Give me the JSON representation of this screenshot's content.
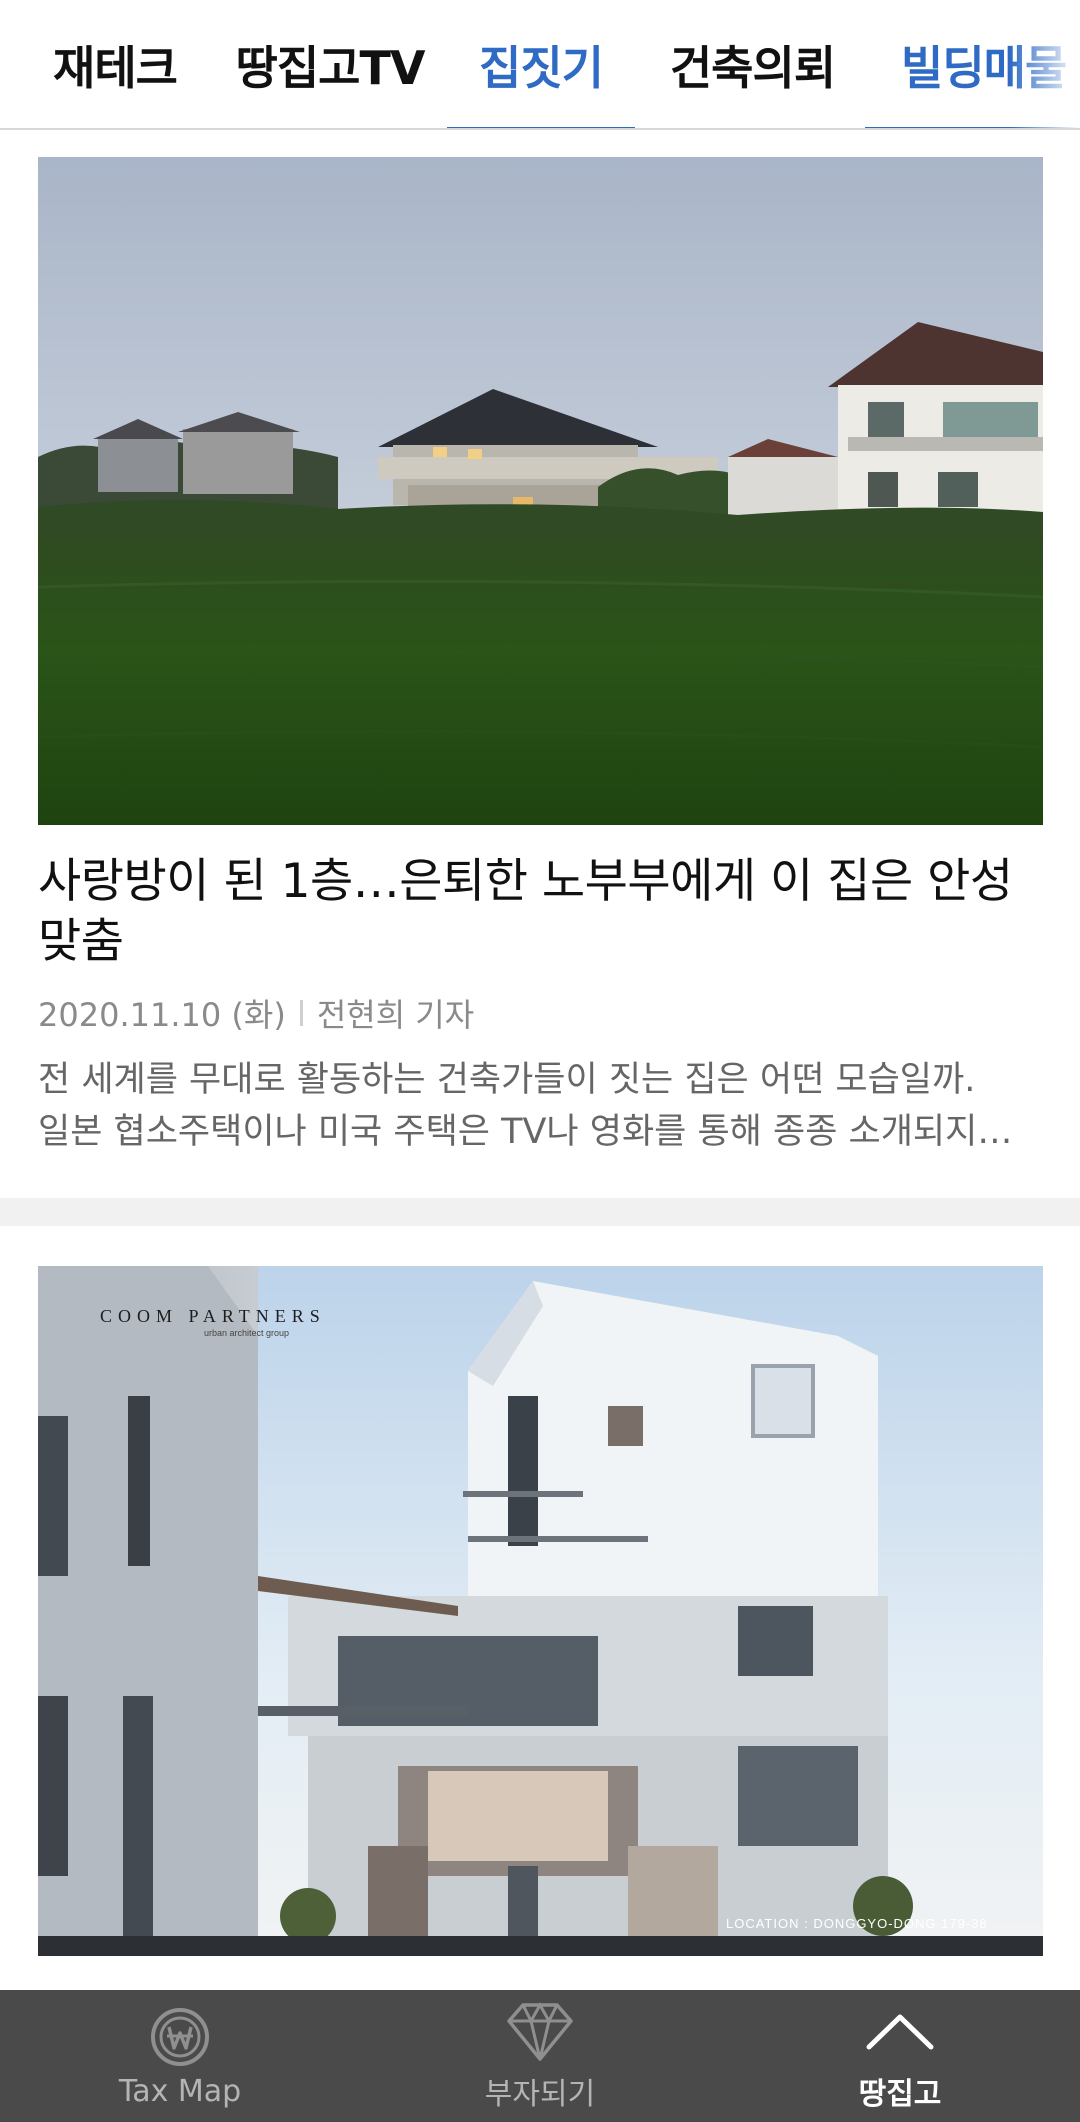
{
  "tabs": [
    {
      "label": "재테크",
      "active": false
    },
    {
      "label": "땅집고TV",
      "active": false
    },
    {
      "label": "집짓기",
      "active": true
    },
    {
      "label": "건축의뢰",
      "active": false
    },
    {
      "label": "빌딩매물",
      "active": true
    }
  ],
  "articles": [
    {
      "title": "사랑방이 된 1층…은퇴한 노부부에게 이 집은 안성맞춤",
      "title_line1": "사랑방이 된 1층…은퇴한 노부부에게 이 집은 안성",
      "title_line2": "맞춤",
      "date": "2020.11.10 (화)",
      "author": "전현희 기자",
      "summary_line1": "전 세계를 무대로 활동하는 건축가들이 짓는 집은 어떤 모습일까.",
      "summary_line2": "일본 협소주택이나 미국 주택은 TV나 영화를 통해 종종 소개되지…"
    },
    {
      "image_watermark": "COOM PARTNERS",
      "image_watermark_sub": "urban architect group",
      "image_caption": "LOCATION : DONGGYO-DONG 179-38"
    }
  ],
  "bottom_nav": [
    {
      "label": "Tax Map",
      "icon": "won-coin-icon",
      "active": false
    },
    {
      "label": "부자되기",
      "icon": "diamond-icon",
      "active": false
    },
    {
      "label": "땅집고",
      "icon": "chevron-up-icon",
      "active": true
    }
  ],
  "colors": {
    "accent": "#2f6bc4",
    "nav_bg": "#4a4a4a",
    "divider": "#f1f1f1"
  }
}
